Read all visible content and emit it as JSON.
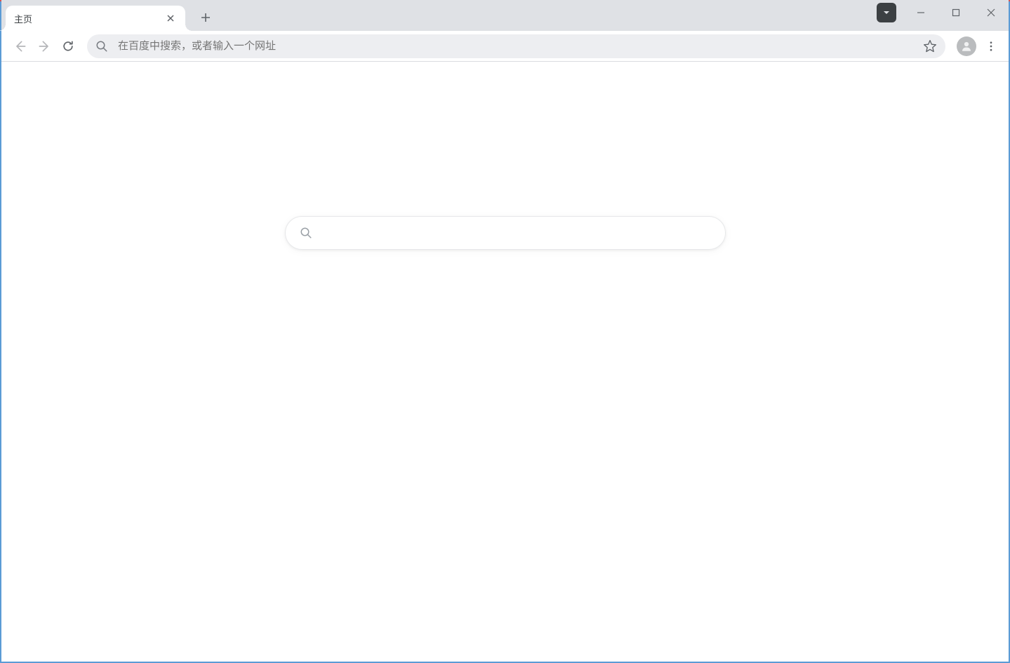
{
  "titlebar": {
    "tab": {
      "title": "主页"
    }
  },
  "toolbar": {
    "omnibox": {
      "placeholder": "在百度中搜索，或者输入一个网址",
      "value": ""
    }
  },
  "content": {
    "search": {
      "placeholder": "",
      "value": ""
    }
  }
}
